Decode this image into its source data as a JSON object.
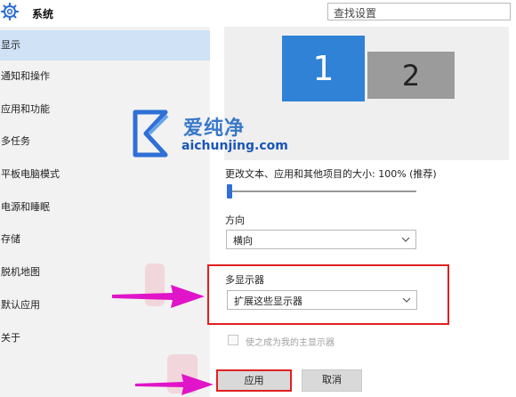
{
  "window": {
    "title": "系统",
    "search_placeholder": "查找设置"
  },
  "sidebar": {
    "items": [
      {
        "label": "显示",
        "active": true
      },
      {
        "label": "通知和操作"
      },
      {
        "label": "应用和功能"
      },
      {
        "label": "多任务"
      },
      {
        "label": "平板电脑模式"
      },
      {
        "label": "电源和睡眠"
      },
      {
        "label": "存储"
      },
      {
        "label": "脱机地图"
      },
      {
        "label": "默认应用"
      },
      {
        "label": "关于"
      }
    ]
  },
  "display": {
    "monitors": [
      {
        "label": "1",
        "selected": true,
        "color": "#2f82d6"
      },
      {
        "label": "2",
        "selected": false,
        "color": "#9b9b9b"
      }
    ],
    "scale_label": "更改文本、应用和其他项目的大小: 100% (推荐)",
    "scale_level": 0,
    "orientation": {
      "label": "方向",
      "value": "横向"
    },
    "multiple_displays": {
      "label": "多显示器",
      "value": "扩展这些显示器"
    },
    "make_main": {
      "label": "使之成为我的主显示器",
      "checked": false,
      "enabled": false
    },
    "apply_label": "应用",
    "cancel_label": "取消"
  },
  "watermark": {
    "text": "爱纯净",
    "url": "aichunjing.com"
  },
  "colors": {
    "accent": "#2f82d6",
    "highlight_red": "#e02020",
    "arrow_magenta": "#e014c8",
    "selected_nav": "#cfe2f6"
  }
}
